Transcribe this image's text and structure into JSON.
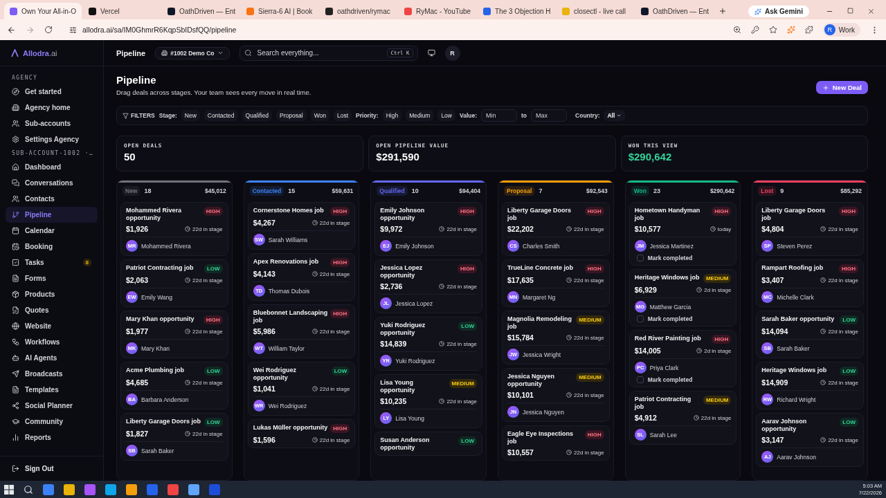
{
  "browser": {
    "tabs": [
      {
        "title": "Own Your All-in-O",
        "selected": true
      },
      {
        "title": "Vercel",
        "selected": false
      },
      {
        "title": "OathDriven — Ent",
        "selected": false
      },
      {
        "title": "Sierra-6 AI | Book",
        "selected": false
      },
      {
        "title": "oathdriven/rymac",
        "selected": false
      },
      {
        "title": "RyMac - YouTube",
        "selected": false
      },
      {
        "title": "The 3 Objection H",
        "selected": false
      },
      {
        "title": "closectl - live call",
        "selected": false
      },
      {
        "title": "OathDriven — Ent",
        "selected": false
      }
    ],
    "gemini": "Ask Gemini",
    "url": "allodra.ai/sa/IM0GhmrR6KqpSbIDsfQQ/pipeline",
    "profile_initial": "R",
    "profile": "Work"
  },
  "sidebar": {
    "logo": "Allodra",
    "logo_suffix": ".ai",
    "sections": [
      {
        "heading": "AGENCY",
        "items": [
          {
            "label": "Get started",
            "selected": false
          },
          {
            "label": "Agency home",
            "selected": false
          },
          {
            "label": "Sub-accounts",
            "selected": false
          },
          {
            "label": "Settings Agency",
            "selected": false
          }
        ]
      },
      {
        "heading": "SUB-ACCOUNT-1002 ·…",
        "items": [
          {
            "label": "Dashboard",
            "selected": false
          },
          {
            "label": "Conversations",
            "selected": false
          },
          {
            "label": "Contacts",
            "selected": false
          },
          {
            "label": "Pipeline",
            "selected": true
          },
          {
            "label": "Calendar",
            "selected": false
          },
          {
            "label": "Booking",
            "selected": false
          },
          {
            "label": "Tasks",
            "selected": false,
            "badge": "8"
          },
          {
            "label": "Forms",
            "selected": false
          },
          {
            "label": "Products",
            "selected": false
          },
          {
            "label": "Quotes",
            "selected": false
          },
          {
            "label": "Website",
            "selected": false
          },
          {
            "label": "Workflows",
            "selected": false
          },
          {
            "label": "AI Agents",
            "selected": false
          },
          {
            "label": "Broadcasts",
            "selected": false
          },
          {
            "label": "Templates",
            "selected": false
          },
          {
            "label": "Social Planner",
            "selected": false
          },
          {
            "label": "Community",
            "selected": false
          },
          {
            "label": "Reports",
            "selected": false
          }
        ]
      }
    ],
    "sign_out": "Sign Out"
  },
  "topbar": {
    "title": "Pipeline",
    "account": "#1002 Demo Co",
    "search_placeholder": "Search everything...",
    "shortcut": "Ctrl K",
    "avatar": "R"
  },
  "header": {
    "title": "Pipeline",
    "subtitle": "Drag deals across stages. Your team sees every move in real time.",
    "new_button": "New Deal"
  },
  "filters": {
    "label": "FILTERS",
    "stage_label": "Stage:",
    "stages": [
      "New",
      "Contacted",
      "Qualified",
      "Proposal",
      "Won",
      "Lost"
    ],
    "priority_label": "Priority:",
    "priorities": [
      "High",
      "Medium",
      "Low"
    ],
    "value_label": "Value:",
    "min_placeholder": "Min",
    "to": "to",
    "max_placeholder": "Max",
    "country_label": "Country:",
    "country": "All"
  },
  "stats": [
    {
      "label": "OPEN DEALS",
      "value": "50",
      "kind": "plain"
    },
    {
      "label": "OPEN PIPELINE VALUE",
      "value": "$291,590",
      "kind": "plain"
    },
    {
      "label": "WON THIS VIEW",
      "value": "$290,642",
      "kind": "positive"
    }
  ],
  "columns": [
    {
      "name": "New",
      "count": "18",
      "total": "$45,012",
      "color": "#71717a",
      "cards": [
        {
          "title": "Mohammed Rivera opportunity",
          "priority": "HIGH",
          "kind": "high",
          "amount": "$1,926",
          "age": "22d in stage",
          "contact": "Mohammed Rivera",
          "initials": "MR"
        },
        {
          "title": "Patriot Contracting job",
          "priority": "LOW",
          "kind": "low",
          "amount": "$2,063",
          "age": "22d in stage",
          "contact": "Emily Wang",
          "initials": "EW"
        },
        {
          "title": "Mary Khan opportunity",
          "priority": "HIGH",
          "kind": "high",
          "amount": "$1,977",
          "age": "22d in stage",
          "contact": "Mary Khan",
          "initials": "MK"
        },
        {
          "title": "Acme Plumbing job",
          "priority": "LOW",
          "kind": "low",
          "amount": "$4,685",
          "age": "22d in stage",
          "contact": "Barbara Anderson",
          "initials": "BA"
        },
        {
          "title": "Liberty Garage Doors job",
          "priority": "LOW",
          "kind": "low",
          "amount": "$1,827",
          "age": "22d in stage",
          "contact": "Sarah Baker",
          "initials": "SB"
        }
      ]
    },
    {
      "name": "Contacted",
      "count": "15",
      "total": "$59,631",
      "color": "#3b82f6",
      "cards": [
        {
          "title": "Cornerstone Homes job",
          "priority": "HIGH",
          "kind": "high",
          "amount": "$4,267",
          "age": "22d in stage",
          "contact": "Sarah Williams",
          "initials": "SW"
        },
        {
          "title": "Apex Renovations job",
          "priority": "HIGH",
          "kind": "high",
          "amount": "$4,143",
          "age": "22d in stage",
          "contact": "Thomas Dubois",
          "initials": "TD"
        },
        {
          "title": "Bluebonnet Landscaping job",
          "priority": "HIGH",
          "kind": "high",
          "amount": "$5,986",
          "age": "22d in stage",
          "contact": "William Taylor",
          "initials": "WT"
        },
        {
          "title": "Wei Rodriguez opportunity",
          "priority": "LOW",
          "kind": "low",
          "amount": "$1,041",
          "age": "22d in stage",
          "contact": "Wei Rodriguez",
          "initials": "WR"
        },
        {
          "title": "Lukas Müller opportunity",
          "priority": "HIGH",
          "kind": "high",
          "amount": "$1,596",
          "age": "22d in stage"
        }
      ]
    },
    {
      "name": "Qualified",
      "count": "10",
      "total": "$94,404",
      "color": "#6366f1",
      "cards": [
        {
          "title": "Emily Johnson opportunity",
          "priority": "HIGH",
          "kind": "high",
          "amount": "$9,972",
          "age": "22d in stage",
          "contact": "Emily Johnson",
          "initials": "EJ"
        },
        {
          "title": "Jessica Lopez opportunity",
          "priority": "HIGH",
          "kind": "high",
          "amount": "$2,736",
          "age": "22d in stage",
          "contact": "Jessica Lopez",
          "initials": "JL"
        },
        {
          "title": "Yuki Rodriguez opportunity",
          "priority": "LOW",
          "kind": "low",
          "amount": "$14,839",
          "age": "22d in stage",
          "contact": "Yuki Rodriguez",
          "initials": "YR"
        },
        {
          "title": "Lisa Young opportunity",
          "priority": "MEDIUM",
          "kind": "medium",
          "amount": "$10,235",
          "age": "22d in stage",
          "contact": "Lisa Young",
          "initials": "LY"
        },
        {
          "title": "Susan Anderson opportunity",
          "priority": "LOW",
          "kind": "low"
        }
      ]
    },
    {
      "name": "Proposal",
      "count": "7",
      "total": "$92,543",
      "color": "#f59e0b",
      "cards": [
        {
          "title": "Liberty Garage Doors job",
          "priority": "HIGH",
          "kind": "high",
          "amount": "$22,202",
          "age": "22d in stage",
          "contact": "Charles Smith",
          "initials": "CS"
        },
        {
          "title": "TrueLine Concrete job",
          "priority": "HIGH",
          "kind": "high",
          "amount": "$17,635",
          "age": "22d in stage",
          "contact": "Margaret Ng",
          "initials": "MN"
        },
        {
          "title": "Magnolia Remodeling job",
          "priority": "MEDIUM",
          "kind": "medium",
          "amount": "$15,784",
          "age": "22d in stage",
          "contact": "Jessica Wright",
          "initials": "JW"
        },
        {
          "title": "Jessica Nguyen opportunity",
          "priority": "MEDIUM",
          "kind": "medium",
          "amount": "$10,101",
          "age": "22d in stage",
          "contact": "Jessica Nguyen",
          "initials": "JN"
        },
        {
          "title": "Eagle Eye Inspections job",
          "priority": "HIGH",
          "kind": "high",
          "amount": "$10,557",
          "age": "22d in stage"
        }
      ]
    },
    {
      "name": "Won",
      "count": "23",
      "total": "$290,642",
      "color": "#10b981",
      "cards": [
        {
          "title": "Hometown Handyman job",
          "priority": "HIGH",
          "kind": "high",
          "amount": "$10,577",
          "age": "today",
          "contact": "Jessica Martinez",
          "initials": "JM",
          "task": {
            "label": "Mark completed",
            "checked": false
          }
        },
        {
          "title": "Heritage Windows job",
          "priority": "MEDIUM",
          "kind": "medium",
          "amount": "$6,929",
          "age": "2d in stage",
          "contact": "Matthew Garcia",
          "initials": "MG",
          "task": {
            "label": "Mark completed",
            "checked": false
          }
        },
        {
          "title": "Red River Painting job",
          "priority": "HIGH",
          "kind": "high",
          "amount": "$14,005",
          "age": "2d in stage",
          "contact": "Priya Clark",
          "initials": "PC",
          "task": {
            "label": "Mark completed",
            "checked": false
          }
        },
        {
          "title": "Patriot Contracting job",
          "priority": "MEDIUM",
          "kind": "medium",
          "amount": "$4,912",
          "age": "22d in stage",
          "contact": "Sarah Lee",
          "initials": "SL"
        }
      ]
    },
    {
      "name": "Lost",
      "count": "9",
      "total": "$85,292",
      "color": "#f43f5e",
      "cards": [
        {
          "title": "Liberty Garage Doors job",
          "priority": "HIGH",
          "kind": "high",
          "amount": "$4,804",
          "age": "22d in stage",
          "contact": "Steven Perez",
          "initials": "SP"
        },
        {
          "title": "Rampart Roofing job",
          "priority": "HIGH",
          "kind": "high",
          "amount": "$3,407",
          "age": "22d in stage",
          "contact": "Michelle Clark",
          "initials": "MC"
        },
        {
          "title": "Sarah Baker opportunity",
          "priority": "LOW",
          "kind": "low",
          "amount": "$14,094",
          "age": "22d in stage",
          "contact": "Sarah Baker",
          "initials": "SB"
        },
        {
          "title": "Heritage Windows job",
          "priority": "LOW",
          "kind": "low",
          "amount": "$14,909",
          "age": "22d in stage",
          "contact": "Richard Wright",
          "initials": "RW"
        },
        {
          "title": "Aarav Johnson opportunity",
          "priority": "LOW",
          "kind": "low",
          "amount": "$3,147",
          "age": "22d in stage",
          "contact": "Aarav Johnson",
          "initials": "AJ"
        }
      ]
    }
  ],
  "taskbar": {
    "time": "5:03 AM",
    "date": "7/22/2026"
  }
}
